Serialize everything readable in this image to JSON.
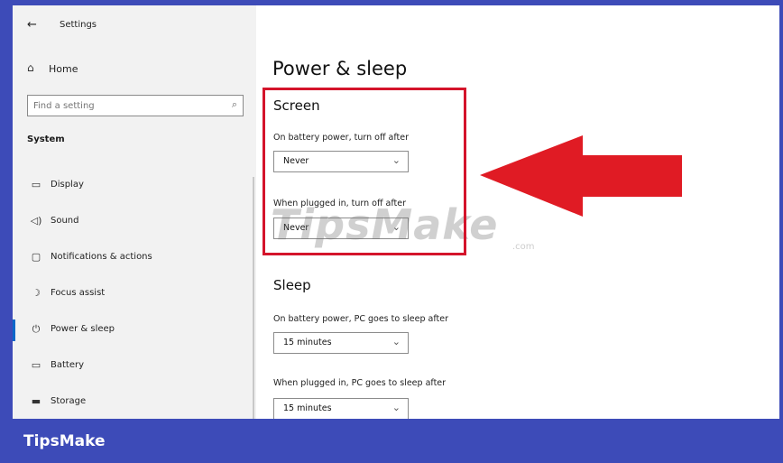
{
  "window": {
    "title": "Settings",
    "back_icon": "arrow-left-icon"
  },
  "sidebar": {
    "home": {
      "label": "Home",
      "icon": "home-icon"
    },
    "search": {
      "placeholder": "Find a setting",
      "icon": "search-icon"
    },
    "section_header": "System",
    "items": [
      {
        "label": "Display",
        "icon": "monitor-icon",
        "active": false
      },
      {
        "label": "Sound",
        "icon": "speaker-icon",
        "active": false
      },
      {
        "label": "Notifications & actions",
        "icon": "message-icon",
        "active": false
      },
      {
        "label": "Focus assist",
        "icon": "moon-icon",
        "active": false
      },
      {
        "label": "Power & sleep",
        "icon": "power-icon",
        "active": true
      },
      {
        "label": "Battery",
        "icon": "battery-icon",
        "active": false
      },
      {
        "label": "Storage",
        "icon": "storage-icon",
        "active": false
      }
    ]
  },
  "main": {
    "title": "Power & sleep",
    "screen": {
      "title": "Screen",
      "battery_label": "On battery power, turn off after",
      "battery_value": "Never",
      "plugged_label": "When plugged in, turn off after",
      "plugged_value": "Never"
    },
    "sleep": {
      "title": "Sleep",
      "battery_label": "On battery power, PC goes to sleep after",
      "battery_value": "15 minutes",
      "plugged_label": "When plugged in, PC goes to sleep after",
      "plugged_value": "15 minutes"
    }
  },
  "annotation": {
    "highlight_color": "#d4142b",
    "arrow_color": "#e01b24"
  },
  "watermark": {
    "text": "TipsMake",
    "suffix": ".com"
  },
  "footer": {
    "brand": "TipsMake",
    "color": "#3d4bb8"
  }
}
